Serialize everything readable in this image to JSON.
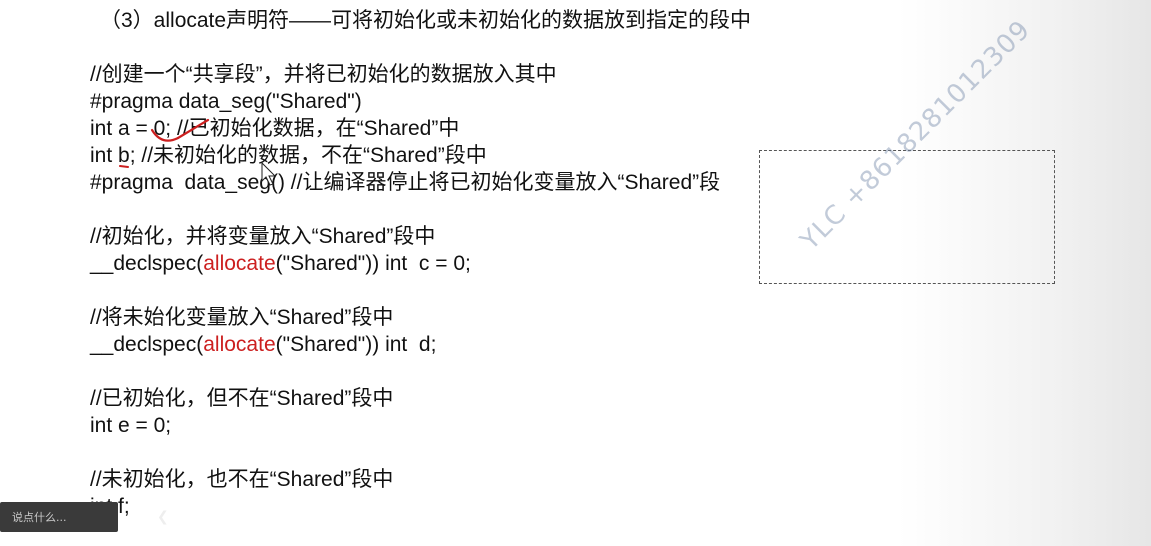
{
  "slide": {
    "heading": "（3）allocate声明符——可将初始化或未初始化的数据放到指定的段中",
    "block1": {
      "comment": "//创建一个“共享段”，并将已初始化的数据放入其中",
      "pragma_open": "#pragma data_seg(\"Shared\")",
      "init_var": "int a = 0; //已初始化数据，在“Shared”中",
      "uninit_var": "int b; //未初始化的数据，不在“Shared”段中",
      "pragma_close": "#pragma  data_seg() //让编译器停止将已初始化变量放入“Shared”段"
    },
    "block2": {
      "comment": "//初始化，并将变量放入“Shared”段中",
      "prefix": "__declspec(",
      "keyword": "allocate",
      "suffix": "(\"Shared\")) int  c = 0;"
    },
    "block3": {
      "comment": "//将未始化变量放入“Shared”段中",
      "prefix": "__declspec(",
      "keyword": "allocate",
      "suffix": "(\"Shared\")) int  d;"
    },
    "block4": {
      "comment": "//已初始化，但不在“Shared”段中",
      "code": "int e = 0;"
    },
    "block5": {
      "comment": "//未初始化，也不在“Shared”段中",
      "code": "int f;"
    }
  },
  "watermark": "YLC +8618281012309",
  "chat_widget": {
    "placeholder": "说点什么...",
    "toggle_icon": "chevron-left-icon"
  },
  "colors": {
    "keyword": "#cc1f1f",
    "annotation": "#cc1f1f",
    "watermark": "#788caa"
  }
}
